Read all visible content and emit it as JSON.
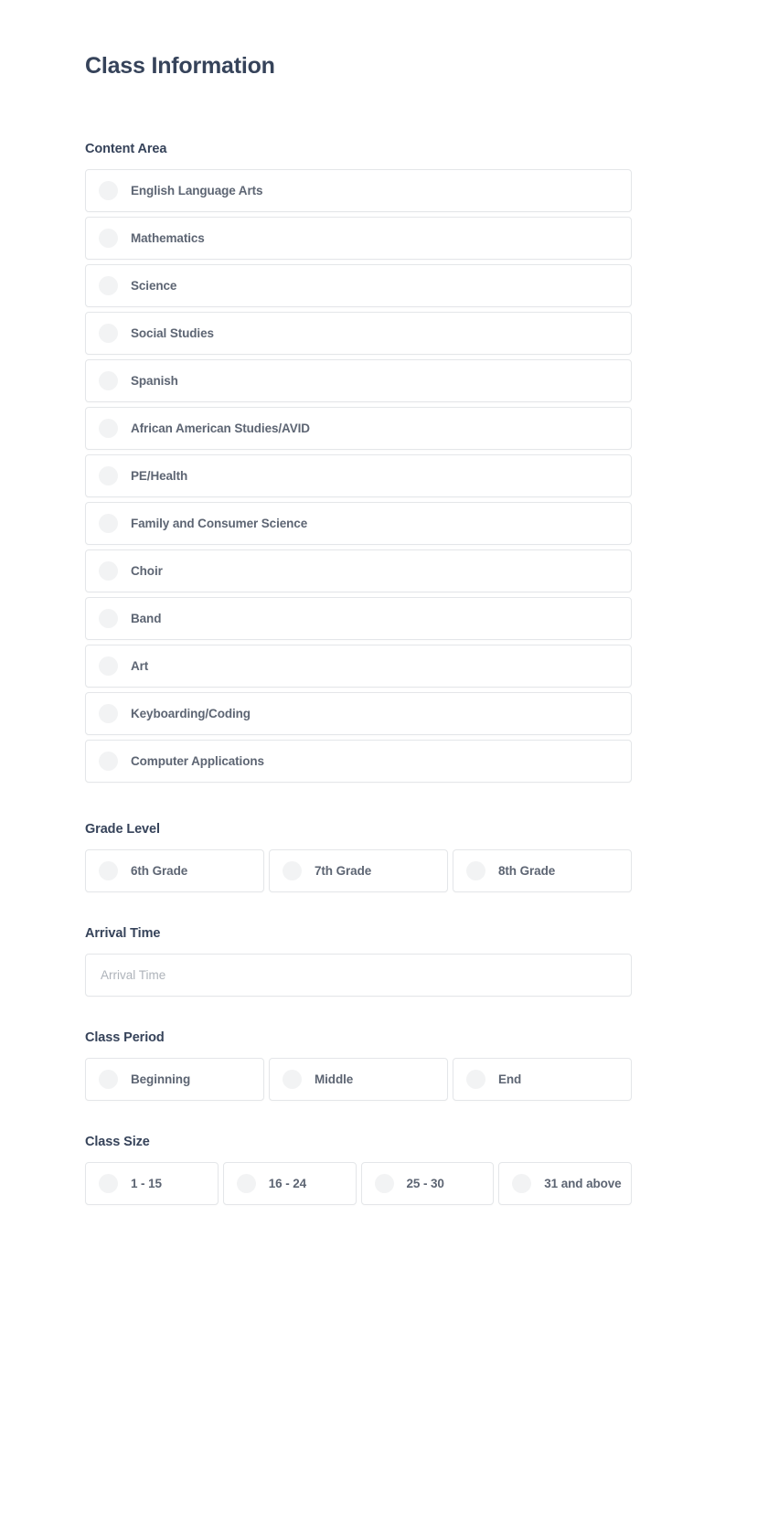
{
  "page": {
    "title": "Class Information"
  },
  "sections": {
    "content_area": {
      "label": "Content Area",
      "options": [
        {
          "label": "English Language Arts"
        },
        {
          "label": "Mathematics"
        },
        {
          "label": "Science"
        },
        {
          "label": "Social Studies"
        },
        {
          "label": "Spanish"
        },
        {
          "label": "African American Studies/AVID"
        },
        {
          "label": "PE/Health"
        },
        {
          "label": "Family and Consumer Science"
        },
        {
          "label": "Choir"
        },
        {
          "label": "Band"
        },
        {
          "label": "Art"
        },
        {
          "label": "Keyboarding/Coding"
        },
        {
          "label": "Computer Applications"
        }
      ]
    },
    "grade_level": {
      "label": "Grade Level",
      "options": [
        {
          "label": "6th Grade"
        },
        {
          "label": "7th Grade"
        },
        {
          "label": "8th Grade"
        }
      ]
    },
    "arrival_time": {
      "label": "Arrival Time",
      "placeholder": "Arrival Time",
      "value": ""
    },
    "class_period": {
      "label": "Class Period",
      "options": [
        {
          "label": "Beginning"
        },
        {
          "label": "Middle"
        },
        {
          "label": "End"
        }
      ]
    },
    "class_size": {
      "label": "Class Size",
      "options": [
        {
          "label": "1 - 15"
        },
        {
          "label": "16 - 24"
        },
        {
          "label": "25 - 30"
        },
        {
          "label": "31 and above"
        }
      ]
    }
  },
  "colors": {
    "heading": "#36435a",
    "option_text": "#5d6573",
    "border": "#e4e6e9",
    "radio_fill": "#f2f3f4",
    "placeholder": "#aeb3ba",
    "background": "#ffffff"
  },
  "icons": {
    "radio": "radio-button-icon"
  }
}
